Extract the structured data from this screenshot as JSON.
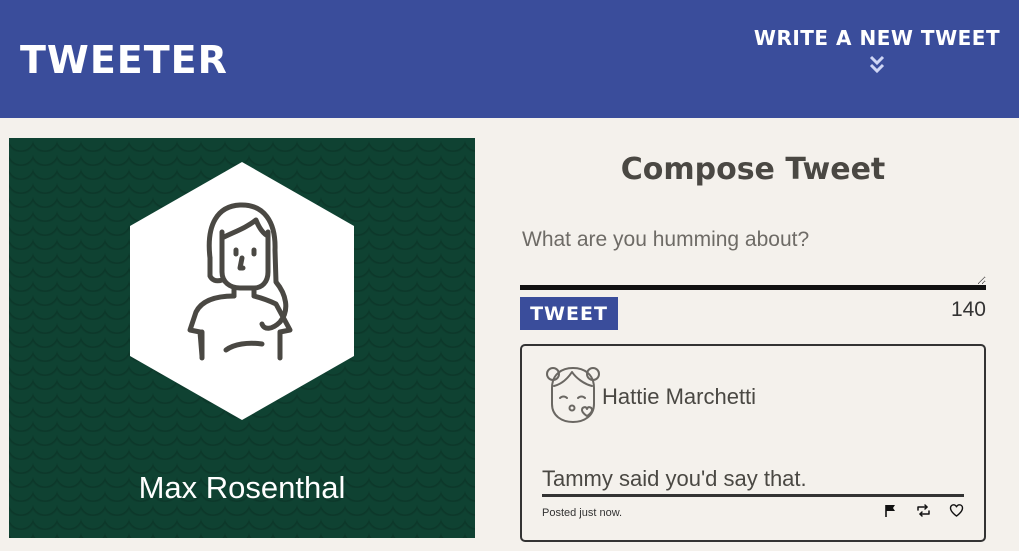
{
  "navbar": {
    "brand": "TWEETER",
    "write_label": "WRITE A NEW TWEET",
    "bg_color": "#3a4d9b"
  },
  "profile": {
    "name": "Max Rosenthal",
    "bg_color": "#0f4232",
    "avatar_icon": "woman-avatar-icon"
  },
  "compose": {
    "title": "Compose Tweet",
    "placeholder": "What are you humming about?",
    "button_label": "TWEET",
    "counter": "140"
  },
  "tweet": {
    "user": "Hattie Marchetti",
    "avatar_icon": "kissing-girl-avatar-icon",
    "content": "Tammy said you'd say that.",
    "time": "Posted just now.",
    "actions": [
      "flag-icon",
      "retweet-icon",
      "heart-icon"
    ]
  }
}
